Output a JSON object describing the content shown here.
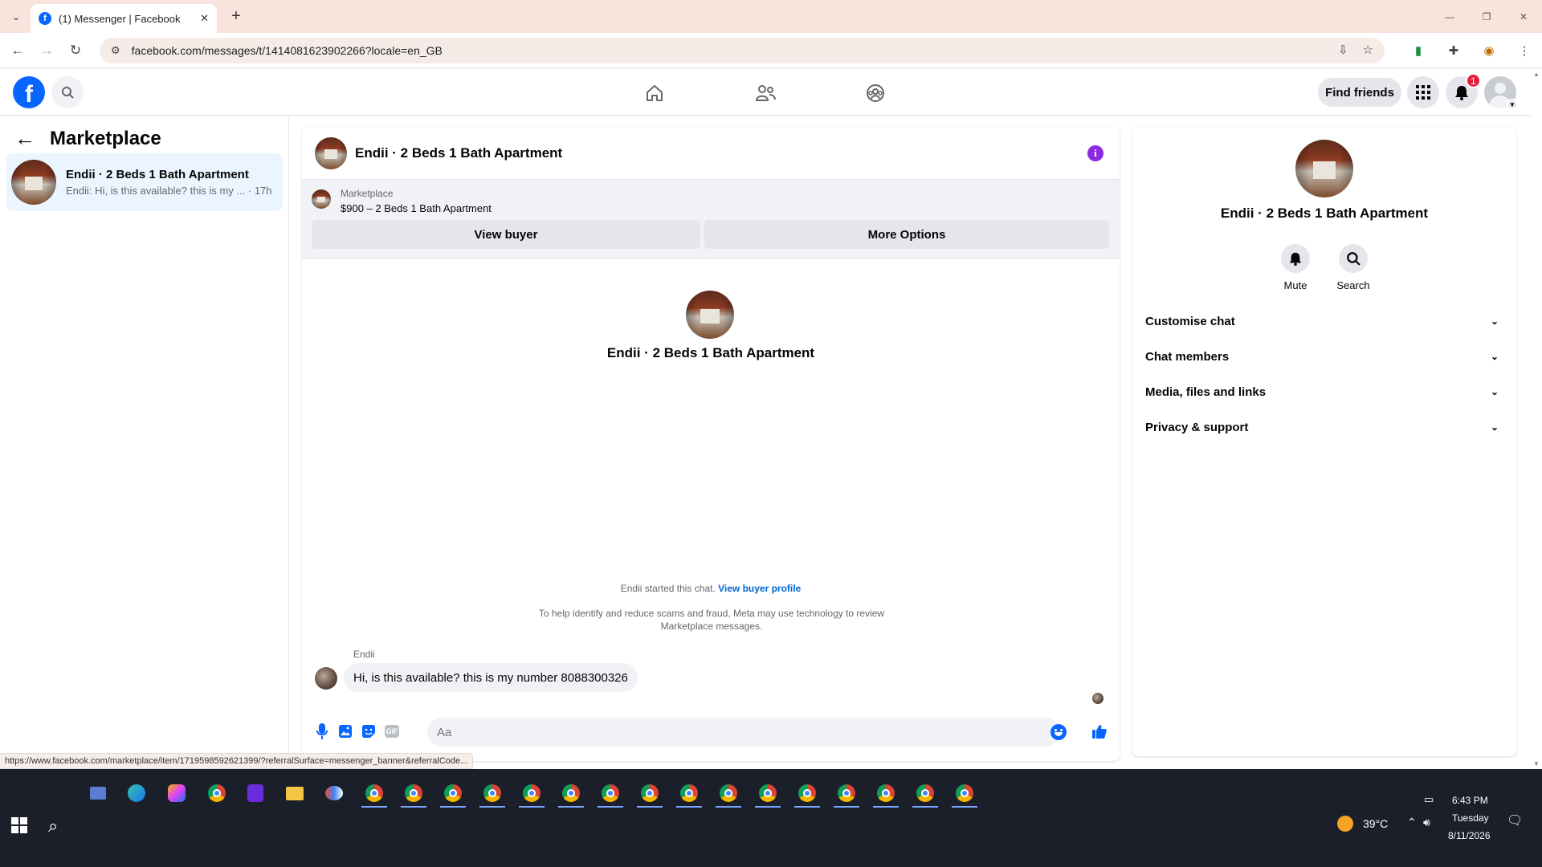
{
  "browser": {
    "tab_title": "(1) Messenger | Facebook",
    "url": "facebook.com/messages/t/1414081623902266?locale=en_GB",
    "status_url": "https://www.facebook.com/marketplace/item/1719598592621399/?referralSurface=messenger_banner&referralCode..."
  },
  "header": {
    "find_friends": "Find friends",
    "notification_count": "1"
  },
  "sidebar": {
    "title": "Marketplace",
    "conversations": [
      {
        "name": "Endii · 2 Beds 1 Bath Apartment",
        "snippet": "Endii: Hi, is this available? this is my ...",
        "time": "· 17h"
      }
    ]
  },
  "chat": {
    "title": "Endii · 2 Beds 1 Bath Apartment",
    "banner": {
      "label": "Marketplace",
      "price_title": "$900 – 2 Beds 1 Bath Apartment",
      "view_buyer": "View buyer",
      "more_options": "More Options"
    },
    "intro_title": "Endii · 2 Beds 1 Bath Apartment",
    "started_text": "Endii started this chat.",
    "started_link": "View buyer profile",
    "meta_note": "To help identify and reduce scams and fraud, Meta may use technology to review Marketplace messages.",
    "sender": "Endii",
    "message": "Hi, is this available? this is my number 8088300326",
    "composer_placeholder": "Aa",
    "gif_label": "GIF"
  },
  "info_panel": {
    "title": "Endii · 2 Beds 1 Bath Apartment",
    "actions": [
      {
        "label": "Mute",
        "icon": "bell-icon"
      },
      {
        "label": "Search",
        "icon": "search-icon"
      }
    ],
    "sections": [
      "Customise chat",
      "Chat members",
      "Media, files and links",
      "Privacy & support"
    ]
  },
  "taskbar": {
    "weather": "39°C",
    "time": "6:43 PM",
    "day": "Tuesday",
    "date": "8/11/2026"
  },
  "colors": {
    "brand": "#0866ff",
    "badge": "#e41e3f",
    "info_icon": "#8a2be2",
    "selected_conversation": "#ebf5ff"
  }
}
